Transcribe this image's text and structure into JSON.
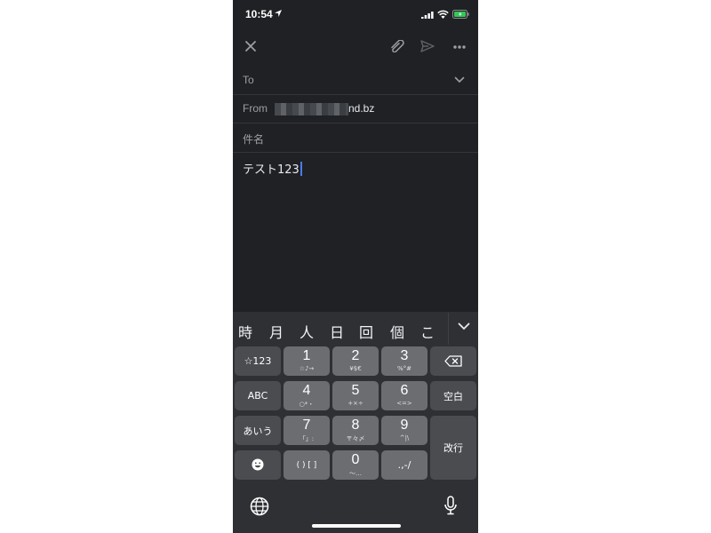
{
  "status_bar": {
    "time": "10:54"
  },
  "compose": {
    "to_label": "To",
    "from_label": "From",
    "from_visible_suffix": "nd.bz",
    "subject_placeholder": "件名",
    "body_text": "テスト123"
  },
  "candidates": [
    "時",
    "月",
    "人",
    "日",
    "回",
    "個",
    "こ"
  ],
  "keyboard": {
    "fn_keys": {
      "symbols": "☆123",
      "abc": "ABC",
      "kana": "あいう",
      "space": "空白",
      "return": "改行",
      "brackets": "( ) [ ]"
    },
    "keys": [
      {
        "big": "1",
        "small": "☆♪→"
      },
      {
        "big": "2",
        "small": "¥$€"
      },
      {
        "big": "3",
        "small": "%°#"
      },
      {
        "big": "4",
        "small": "○*・"
      },
      {
        "big": "5",
        "small": "+×÷"
      },
      {
        "big": "6",
        "small": "<=>"
      },
      {
        "big": "7",
        "small": "「」:"
      },
      {
        "big": "8",
        "small": "〒々〆"
      },
      {
        "big": "9",
        "small": "^|\\"
      },
      {
        "big": "0",
        "small": "〜…"
      },
      {
        "big": ".,-/",
        "small": ""
      }
    ]
  },
  "colors": {
    "background": "#202124",
    "keyboard": "#2e3034",
    "key_number": "#6b6d71",
    "key_function": "#4a4c50",
    "caret": "#4b7bec"
  }
}
